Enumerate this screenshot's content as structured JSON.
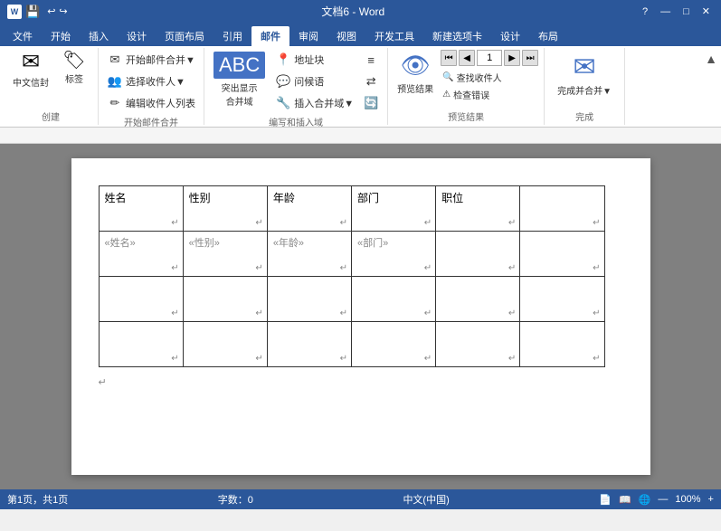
{
  "titleBar": {
    "title": "文档6 - Word",
    "helpBtn": "?",
    "minimizeBtn": "—",
    "maximizeBtn": "□",
    "closeBtn": "✕"
  },
  "ribbonTabs": [
    {
      "label": "文件",
      "active": false
    },
    {
      "label": "开始",
      "active": false
    },
    {
      "label": "插入",
      "active": false
    },
    {
      "label": "设计",
      "active": false
    },
    {
      "label": "页面布局",
      "active": false
    },
    {
      "label": "引用",
      "active": false
    },
    {
      "label": "邮件",
      "active": true
    },
    {
      "label": "审阅",
      "active": false
    },
    {
      "label": "视图",
      "active": false
    },
    {
      "label": "开发工具",
      "active": false
    },
    {
      "label": "新建选项卡",
      "active": false
    },
    {
      "label": "设计",
      "active": false
    },
    {
      "label": "布局",
      "active": false
    }
  ],
  "ribbon": {
    "groups": [
      {
        "name": "创建",
        "buttons": [
          {
            "type": "large",
            "icon": "✉",
            "label": "中文信封"
          },
          {
            "type": "large",
            "icon": "🏷",
            "label": "标签"
          }
        ]
      },
      {
        "name": "开始邮件合并",
        "buttons": [
          {
            "type": "small",
            "icon": "✉",
            "label": "开始邮件合并▼"
          },
          {
            "type": "small",
            "icon": "👥",
            "label": "选择收件人▼"
          },
          {
            "type": "small",
            "icon": "✏",
            "label": "编辑收件人列表"
          }
        ]
      },
      {
        "name": "编写和插入域",
        "buttons": [
          {
            "type": "large",
            "icon": "🔲",
            "label": "突出显示\n合并域"
          },
          {
            "type": "small",
            "icon": "📍",
            "label": "地址块"
          },
          {
            "type": "small",
            "icon": "💬",
            "label": "问候语"
          },
          {
            "type": "small",
            "icon": "🔧",
            "label": "插入合并域▼"
          }
        ]
      },
      {
        "name": "预览结果",
        "navInput": "1",
        "subButtons": [
          {
            "icon": "🔍",
            "label": "查找收件人"
          },
          {
            "icon": "⚠",
            "label": "检查错误"
          }
        ],
        "previewBtn": "预览结果"
      },
      {
        "name": "完成",
        "button": {
          "icon": "✅",
          "label": "完成并合并▼"
        }
      }
    ]
  },
  "table": {
    "headers": [
      "姓名",
      "性别",
      "年龄",
      "部门",
      "职位"
    ],
    "mergeRow": [
      "«姓名»",
      "«性别»",
      "«年龄»",
      "«部门»",
      "",
      ""
    ],
    "emptyRows": 2,
    "pilcrow": "↵"
  },
  "statusBar": {
    "pageInfo": "第1页，共1页",
    "wordCount": "字数：0",
    "language": "中文(中国)"
  }
}
